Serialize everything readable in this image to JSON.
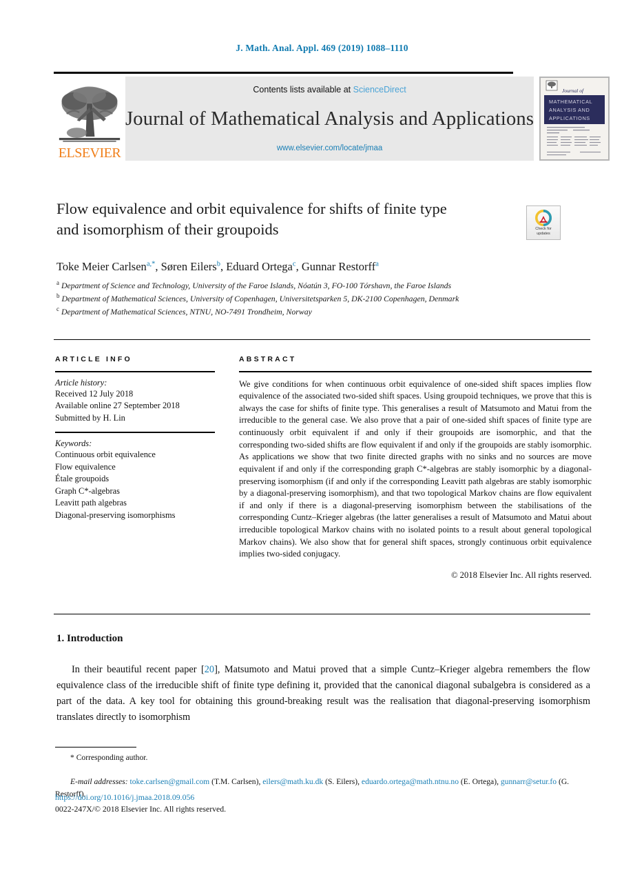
{
  "running_head": "J. Math. Anal. Appl. 469 (2019) 1088–1110",
  "masthead": {
    "contents_prefix": "Contents lists available at ",
    "contents_link": "ScienceDirect",
    "journal_title": "Journal of Mathematical Analysis and Applications",
    "journal_url": "www.elsevier.com/locate/jmaa",
    "publisher": "ELSEVIER",
    "cover_journal_of": "Journal of",
    "cover_title_line1": "MATHEMATICAL",
    "cover_title_line2": "ANALYSIS AND",
    "cover_title_line3": "APPLICATIONS"
  },
  "title": {
    "line1": "Flow equivalence and orbit equivalence for shifts of finite type",
    "line2": "and isomorphism of their groupoids"
  },
  "crossmark": {
    "label_line1": "Check for",
    "label_line2": "updates"
  },
  "authors": [
    {
      "name": "Toke Meier Carlsen",
      "sup": "a,*"
    },
    {
      "name": "Søren Eilers",
      "sup": "b"
    },
    {
      "name": "Eduard Ortega",
      "sup": "c"
    },
    {
      "name": "Gunnar Restorff",
      "sup": "a"
    }
  ],
  "affiliations": [
    {
      "mark": "a",
      "text": "Department of Science and Technology, University of the Faroe Islands, Nóatún 3, FO-100 Tórshavn, the Faroe Islands"
    },
    {
      "mark": "b",
      "text": "Department of Mathematical Sciences, University of Copenhagen, Universitetsparken 5, DK-2100 Copenhagen, Denmark"
    },
    {
      "mark": "c",
      "text": "Department of Mathematical Sciences, NTNU, NO-7491 Trondheim, Norway"
    }
  ],
  "article_info": {
    "heading": "ARTICLE INFO",
    "history_label": "Article history:",
    "history": [
      "Received 12 July 2018",
      "Available online 27 September 2018",
      "Submitted by H. Lin"
    ],
    "keywords_label": "Keywords:",
    "keywords": [
      "Continuous orbit equivalence",
      "Flow equivalence",
      "Étale groupoids",
      "Graph C*-algebras",
      "Leavitt path algebras",
      "Diagonal-preserving isomorphisms"
    ]
  },
  "abstract": {
    "heading": "ABSTRACT",
    "text": "We give conditions for when continuous orbit equivalence of one-sided shift spaces implies flow equivalence of the associated two-sided shift spaces. Using groupoid techniques, we prove that this is always the case for shifts of finite type. This generalises a result of Matsumoto and Matui from the irreducible to the general case. We also prove that a pair of one-sided shift spaces of finite type are continuously orbit equivalent if and only if their groupoids are isomorphic, and that the corresponding two-sided shifts are flow equivalent if and only if the groupoids are stably isomorphic. As applications we show that two finite directed graphs with no sinks and no sources are move equivalent if and only if the corresponding graph C*-algebras are stably isomorphic by a diagonal-preserving isomorphism (if and only if the corresponding Leavitt path algebras are stably isomorphic by a diagonal-preserving isomorphism), and that two topological Markov chains are flow equivalent if and only if there is a diagonal-preserving isomorphism between the stabilisations of the corresponding Cuntz–Krieger algebras (the latter generalises a result of Matsumoto and Matui about irreducible topological Markov chains with no isolated points to a result about general topological Markov chains). We also show that for general shift spaces, strongly continuous orbit equivalence implies two-sided conjugacy.",
    "copyright": "© 2018 Elsevier Inc. All rights reserved."
  },
  "introduction": {
    "heading": "1. Introduction",
    "para_a": "In their beautiful recent paper [",
    "citation": "20",
    "para_b": "], Matsumoto and Matui proved that a simple Cuntz–Krieger algebra remembers the flow equivalence class of the irreducible shift of finite type defining it, provided that the canonical diagonal subalgebra is considered as a part of the data. A key tool for obtaining this ground-breaking result was the realisation that diagonal-preserving isomorphism translates directly to isomorphism"
  },
  "footnotes": {
    "corresponding": "* Corresponding author.",
    "email_label": "E-mail addresses:",
    "emails": [
      {
        "address": "toke.carlsen@gmail.com",
        "who": "(T.M. Carlsen)"
      },
      {
        "address": "eilers@math.ku.dk",
        "who": "(S. Eilers)"
      },
      {
        "address": "eduardo.ortega@math.ntnu.no",
        "who": "(E. Ortega)"
      },
      {
        "address": "gunnarr@setur.fo",
        "who": "(G. Restorff)"
      }
    ]
  },
  "doi": {
    "url": "https://doi.org/10.1016/j.jmaa.2018.09.056",
    "issn_line": "0022-247X/© 2018 Elsevier Inc. All rights reserved."
  },
  "colors": {
    "link": "#1a7fb5",
    "running_head": "#0f7ab0",
    "elsevier_orange": "#f07f1a",
    "cover_navy": "#2b2d5c",
    "sciencedirect": "#4aa3d6"
  }
}
